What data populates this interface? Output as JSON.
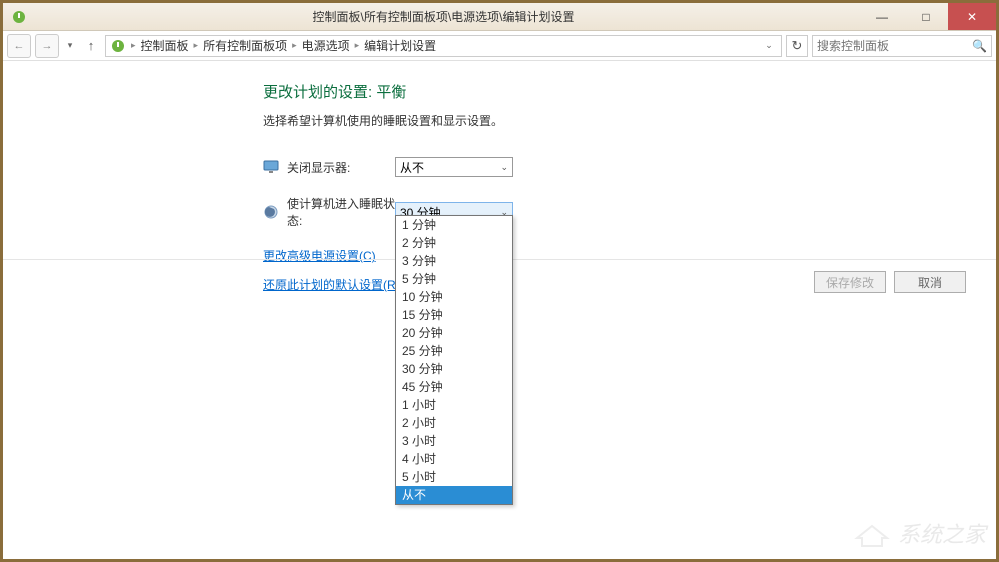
{
  "titlebar": {
    "title": "控制面板\\所有控制面板项\\电源选项\\编辑计划设置"
  },
  "window_controls": {
    "minimize": "—",
    "maximize": "□",
    "close": "✕"
  },
  "breadcrumb": {
    "items": [
      "控制面板",
      "所有控制面板项",
      "电源选项",
      "编辑计划设置"
    ]
  },
  "search": {
    "placeholder": "搜索控制面板"
  },
  "page": {
    "title": "更改计划的设置: 平衡",
    "desc": "选择希望计算机使用的睡眠设置和显示设置。"
  },
  "settings": {
    "display_off": {
      "label": "关闭显示器:",
      "value": "从不"
    },
    "sleep": {
      "label": "使计算机进入睡眠状态:",
      "value": "30 分钟"
    }
  },
  "dropdown_options": [
    "1 分钟",
    "2 分钟",
    "3 分钟",
    "5 分钟",
    "10 分钟",
    "15 分钟",
    "20 分钟",
    "25 分钟",
    "30 分钟",
    "45 分钟",
    "1 小时",
    "2 小时",
    "3 小时",
    "4 小时",
    "5 小时",
    "从不"
  ],
  "dropdown_highlighted": "从不",
  "links": {
    "advanced": "更改高级电源设置(C)",
    "restore": "还原此计划的默认设置(R)"
  },
  "buttons": {
    "save": "保存修改",
    "cancel": "取消"
  },
  "watermark": "系统之家"
}
